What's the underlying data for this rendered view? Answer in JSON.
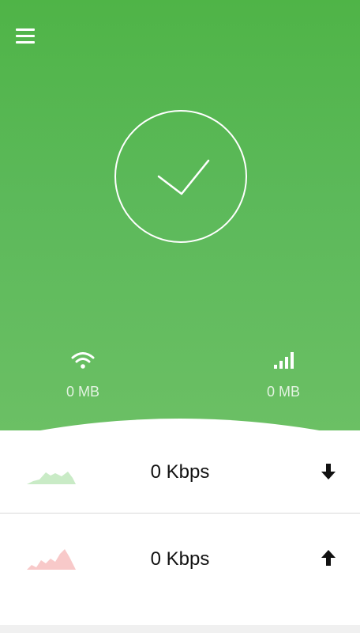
{
  "colors": {
    "accent": "#4fb447",
    "download_graph": "#c9ebc6",
    "upload_graph": "#f8c9c9"
  },
  "header": {
    "menu_icon": "hamburger-menu-icon"
  },
  "status": {
    "icon": "checkmark-icon"
  },
  "stats": {
    "wifi": {
      "icon": "wifi-icon",
      "value": "0 MB"
    },
    "mobile": {
      "icon": "signal-bars-icon",
      "value": "0 MB"
    }
  },
  "download": {
    "speed": "0 Kbps",
    "icon": "arrow-down-icon",
    "graph_icon": "download-graph-icon"
  },
  "upload": {
    "speed": "0 Kbps",
    "icon": "arrow-up-icon",
    "graph_icon": "upload-graph-icon"
  }
}
